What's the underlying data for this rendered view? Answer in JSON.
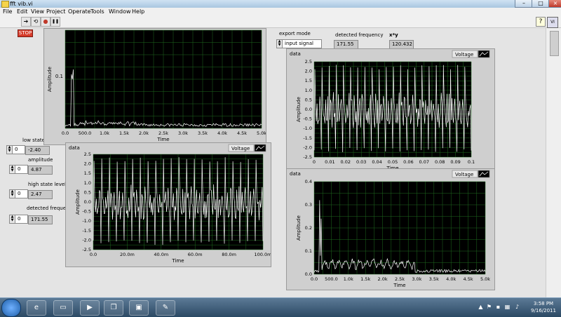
{
  "window": {
    "title": "fft vib.vi",
    "btn_min": "–",
    "btn_max": "□",
    "btn_close": "×"
  },
  "menu": [
    "File",
    "Edit",
    "View",
    "Project",
    "Operate",
    "Tools",
    "Window",
    "Help"
  ],
  "toolbar": {
    "run": "➔",
    "run_continuous": "⟲",
    "abort": "●",
    "pause": "❚❚",
    "help": "?",
    "vi_icon": "VI"
  },
  "stop_label": "STOP",
  "export_mode": {
    "label": "export mode",
    "value": "input signal"
  },
  "detected_frequency": {
    "label": "detected  frequency",
    "value": "171.55"
  },
  "xy": {
    "label": "x*y",
    "value": "120.432"
  },
  "controls": {
    "low_state": {
      "label": "low state level",
      "index": "0",
      "value": "-2.40"
    },
    "amplitude": {
      "label": "amplitude",
      "index": "0",
      "value": "4.87"
    },
    "high_state": {
      "label": "high state level",
      "index": "0",
      "value": "2.47"
    },
    "detected_freqs": {
      "label": "detected frequencies",
      "index": "0",
      "value": "171.55"
    }
  },
  "graphs": [
    {
      "id": "g1",
      "title": "",
      "legend": "",
      "y_label": "Amplitude",
      "x_label": "Time",
      "y_ticks": [
        "0.1"
      ],
      "x_ticks": [
        "0.0",
        "500.0",
        "1.0k",
        "1.5k",
        "2.0k",
        "2.5k",
        "3.0k",
        "3.5k",
        "4.0k",
        "4.5k",
        "5.0k"
      ]
    },
    {
      "id": "g2",
      "title": "data",
      "legend": "Voltage",
      "y_label": "Amplitude",
      "x_label": "Time",
      "y_ticks": [
        "2.5",
        "2.0",
        "1.5",
        "1.0",
        "0.5",
        "0.0",
        "-0.5",
        "-1.0",
        "-1.5",
        "-2.0",
        "-2.5"
      ],
      "x_ticks": [
        "0.0",
        "20.0m",
        "40.0m",
        "60.0m",
        "80.0m",
        "100.0m"
      ]
    },
    {
      "id": "g3",
      "title": "data",
      "legend": "Voltage",
      "y_label": "Amplitude",
      "x_label": "Time",
      "y_ticks": [
        "2.5",
        "2.0",
        "1.5",
        "1.0",
        "0.5",
        "0.0",
        "-0.5",
        "-1.0",
        "-1.5",
        "-2.0",
        "-2.5"
      ],
      "x_ticks": [
        "0",
        "0.01",
        "0.02",
        "0.03",
        "0.04",
        "0.05",
        "0.06",
        "0.07",
        "0.08",
        "0.09",
        "0.1"
      ]
    },
    {
      "id": "g4",
      "title": "data",
      "legend": "Voltage",
      "y_label": "Amplitude",
      "x_label": "Time",
      "y_ticks": [
        "0.4",
        "0.3",
        "0.2",
        "0.1",
        "0.0"
      ],
      "x_ticks": [
        "0.0",
        "500.0",
        "1.0k",
        "1.5k",
        "2.0k",
        "2.5k",
        "3.0k",
        "3.5k",
        "4.0k",
        "4.5k",
        "5.0k"
      ]
    }
  ],
  "taskbar": {
    "time": "3:58 PM",
    "date": "9/16/2011"
  },
  "colors": {
    "plot_bg": "#000000",
    "grid": "#1e6b1e",
    "trace": "#ffffff",
    "panel": "#e4e4e4"
  }
}
